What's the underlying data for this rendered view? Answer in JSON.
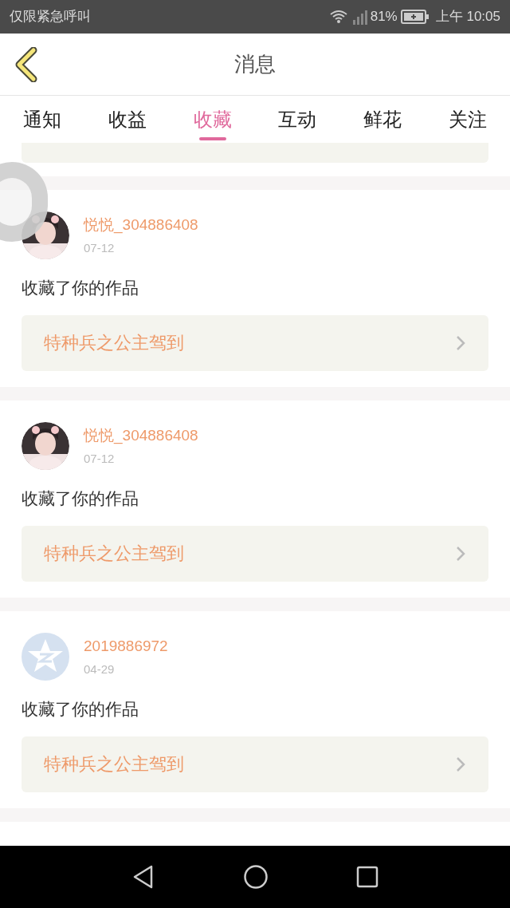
{
  "status_bar": {
    "carrier": "仅限紧急呼叫",
    "battery": "81%",
    "time": "上午 10:05"
  },
  "header": {
    "title": "消息"
  },
  "tabs": [
    {
      "label": "通知",
      "selected": false
    },
    {
      "label": "收益",
      "selected": false
    },
    {
      "label": "收藏",
      "selected": true
    },
    {
      "label": "互动",
      "selected": false
    },
    {
      "label": "鲜花",
      "selected": false
    },
    {
      "label": "关注",
      "selected": false
    }
  ],
  "messages": [
    {
      "user": "悦悦_304886408",
      "date": "07-12",
      "text": "收藏了你的作品",
      "work": "特种兵之公主驾到"
    },
    {
      "user": "悦悦_304886408",
      "date": "07-12",
      "text": "收藏了你的作品",
      "work": "特种兵之公主驾到"
    },
    {
      "user": "2019886972",
      "date": "04-29",
      "avatar": {
        "kind": "default"
      },
      "text": "收藏了你的作品",
      "work": "特种兵之公主驾到"
    }
  ]
}
